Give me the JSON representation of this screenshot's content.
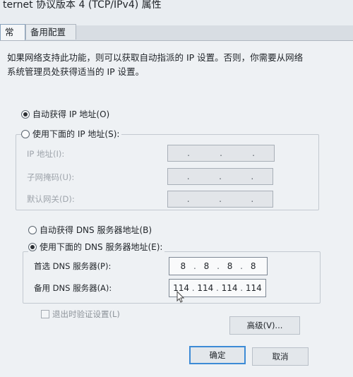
{
  "window": {
    "title": "ternet 协议版本 4 (TCP/IPv4) 属性"
  },
  "tabs": [
    {
      "label": "常规"
    },
    {
      "label": "备用配置"
    }
  ],
  "description": {
    "line1": "如果网络支持此功能，则可以获取自动指派的 IP 设置。否则，你需要从网络",
    "line2": "系统管理员处获得适当的 IP 设置。"
  },
  "ip_section": {
    "auto_label": "自动获得 IP 地址(O)",
    "auto_selected": true,
    "manual_label": "使用下面的 IP 地址(S):",
    "ip_address_label": "IP 地址(I):",
    "subnet_label": "子网掩码(U):",
    "gateway_label": "默认网关(D):"
  },
  "dns_section": {
    "auto_label": "自动获得 DNS 服务器地址(B)",
    "manual_label": "使用下面的 DNS 服务器地址(E):",
    "manual_selected": true,
    "preferred_label": "首选 DNS 服务器(P):",
    "preferred_value": [
      "8",
      "8",
      "8",
      "8"
    ],
    "alternate_label": "备用 DNS 服务器(A):",
    "alternate_value": [
      "114",
      "114",
      "114",
      "114"
    ]
  },
  "validate_checkbox": {
    "label": "退出时验证设置(L)",
    "checked": false
  },
  "buttons": {
    "advanced": "高级(V)...",
    "ok": "确定",
    "cancel": "取消"
  }
}
